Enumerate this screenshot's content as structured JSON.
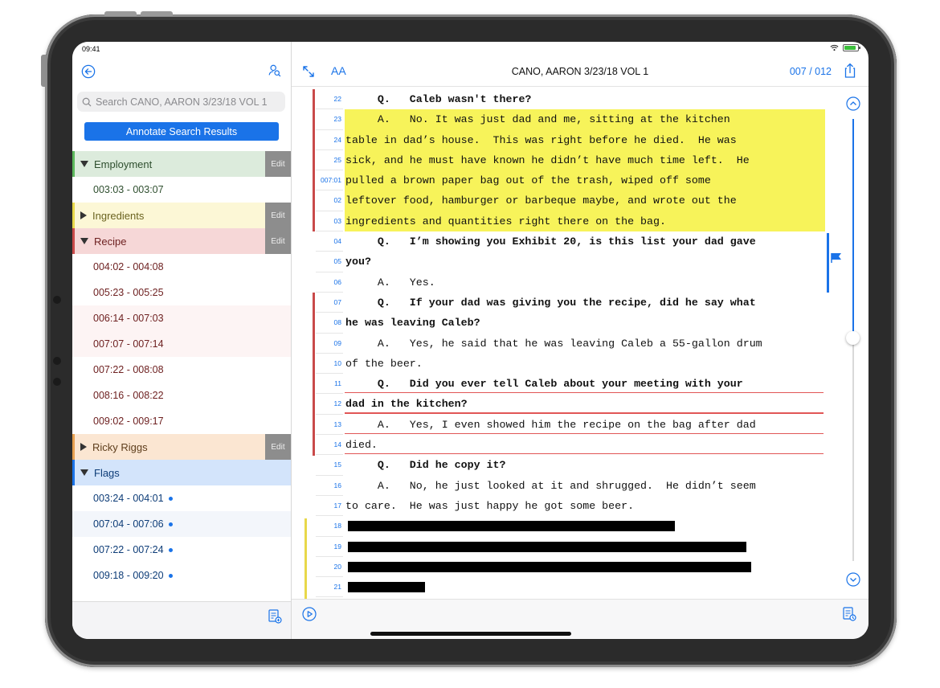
{
  "status": {
    "time": "09:41"
  },
  "sidebar": {
    "search_placeholder": "Search CANO, AARON 3/23/18 VOL 1",
    "annotate_label": "Annotate Search Results",
    "edit_label": "Edit",
    "categories": [
      {
        "name": "Employment",
        "expanded": true,
        "color": "#5cb85c",
        "bg": "#dcebdc",
        "text": "#2f4f2f",
        "ranges": [
          {
            "label": "003:03 - 003:07",
            "bg": "#ffffff"
          }
        ]
      },
      {
        "name": "Ingredients",
        "expanded": false,
        "color": "#e8d84a",
        "bg": "#fcf7d6",
        "text": "#6b6320",
        "ranges": []
      },
      {
        "name": "Recipe",
        "expanded": true,
        "color": "#c94a4a",
        "bg": "#f6d7d7",
        "text": "#6e2121",
        "ranges": [
          {
            "label": "004:02 - 004:08",
            "bg": "#ffffff"
          },
          {
            "label": "005:23 - 005:25",
            "bg": "#ffffff"
          },
          {
            "label": "006:14 - 007:03",
            "bg": "#fdf4f4"
          },
          {
            "label": "007:07 - 007:14",
            "bg": "#fdf4f4"
          },
          {
            "label": "007:22 - 008:08",
            "bg": "#ffffff"
          },
          {
            "label": "008:16 - 008:22",
            "bg": "#ffffff"
          },
          {
            "label": "009:02 - 009:17",
            "bg": "#ffffff"
          }
        ]
      },
      {
        "name": "Ricky Riggs",
        "expanded": false,
        "color": "#e6a050",
        "bg": "#fbe6d2",
        "text": "#5e3e1c",
        "ranges": []
      },
      {
        "name": "Flags",
        "expanded": true,
        "color": "#1a73e8",
        "bg": "#d3e4fb",
        "text": "#0d3c77",
        "edit": false,
        "ranges": [
          {
            "label": "003:24 - 004:01",
            "bg": "#ffffff",
            "dot": true
          },
          {
            "label": "007:04 - 007:06",
            "bg": "#f3f6fb",
            "dot": true
          },
          {
            "label": "007:22 - 007:24",
            "bg": "#ffffff",
            "dot": true
          },
          {
            "label": "009:18 - 009:20",
            "bg": "#ffffff",
            "dot": true
          }
        ]
      }
    ]
  },
  "main": {
    "font_size_label": "AA",
    "title": "CANO, AARON 3/23/18 VOL 1",
    "page_indicator": "007 / 012"
  },
  "transcript": [
    {
      "num": "22",
      "text": "     Q.   Caleb wasn't there?",
      "bold": true
    },
    {
      "num": "23",
      "text": "     A.   No. It was just dad and me, sitting at the kitchen",
      "hl": "yellow"
    },
    {
      "num": "24",
      "text": "table in dad’s house.  This was right before he died.  He was",
      "hl": "yellow"
    },
    {
      "num": "25",
      "text": "sick, and he must have known he didn’t have much time left.  He",
      "hl": "yellow"
    },
    {
      "num": "007:01",
      "text": "pulled a brown paper bag out of the trash, wiped off some",
      "hl": "yellow"
    },
    {
      "num": "02",
      "text": "leftover food, hamburger or barbeque maybe, and wrote out the",
      "hl": "yellow"
    },
    {
      "num": "03",
      "text": "ingredients and quantities right there on the bag.",
      "hl": "yellow"
    },
    {
      "num": "04",
      "text": "     Q.   I’m showing you Exhibit 20, is this list your dad gave",
      "bold": true
    },
    {
      "num": "05",
      "text": "you?",
      "bold": true
    },
    {
      "num": "06",
      "text": "     A.   Yes."
    },
    {
      "num": "07",
      "text": "     Q.   If your dad was giving you the recipe, did he say what",
      "bold": true
    },
    {
      "num": "08",
      "text": "he was leaving Caleb?",
      "bold": true
    },
    {
      "num": "09",
      "text": "     A.   Yes, he said that he was leaving Caleb a 55-gallon drum"
    },
    {
      "num": "10",
      "text": "of the beer."
    },
    {
      "num": "11",
      "text": "     Q.   Did you ever tell Caleb about your meeting with your",
      "bold": true,
      "ul": true
    },
    {
      "num": "12",
      "text": "dad in the kitchen?",
      "bold": true,
      "ul": true
    },
    {
      "num": "13",
      "text": "     A.   Yes, I even showed him the recipe on the bag after dad",
      "ul": true
    },
    {
      "num": "14",
      "text": "died.",
      "ul": true
    },
    {
      "num": "15",
      "text": "     Q.   Did he copy it?",
      "bold": true
    },
    {
      "num": "16",
      "text": "     A.   No, he just looked at it and shrugged.  He didn’t seem"
    },
    {
      "num": "17",
      "text": "to care.  He was just happy he got some beer."
    },
    {
      "num": "18",
      "text": "",
      "redact": 0.68
    },
    {
      "num": "19",
      "text": "",
      "redact": 0.83
    },
    {
      "num": "20",
      "text": "",
      "redact": 0.84
    },
    {
      "num": "21",
      "text": "",
      "redact": 0.16
    }
  ]
}
